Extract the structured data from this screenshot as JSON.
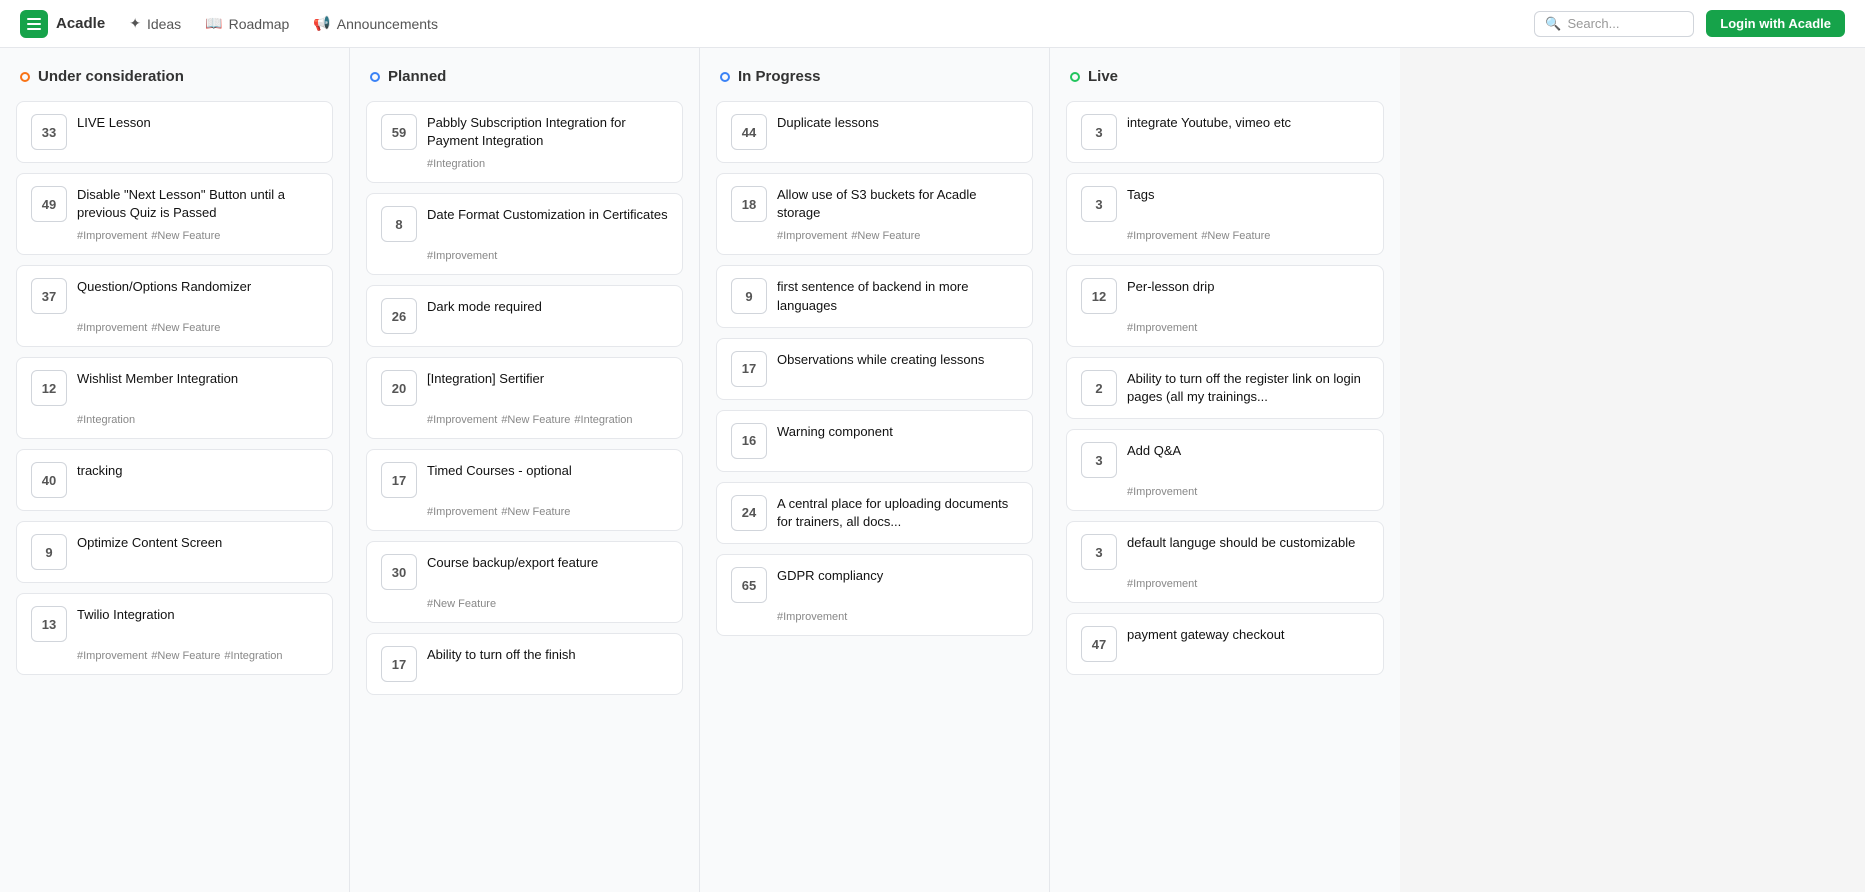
{
  "brand": {
    "name": "Acadle",
    "login_label": "Login with Acadle"
  },
  "nav": [
    {
      "id": "ideas",
      "label": "Ideas",
      "icon": "sparkle"
    },
    {
      "id": "roadmap",
      "label": "Roadmap",
      "icon": "book"
    },
    {
      "id": "announcements",
      "label": "Announcements",
      "icon": "megaphone"
    }
  ],
  "search": {
    "placeholder": "Search..."
  },
  "columns": [
    {
      "id": "under-consideration",
      "title": "Under consideration",
      "dot_class": "dot-orange",
      "cards": [
        {
          "votes": 33,
          "title": "LIVE Lesson",
          "tags": []
        },
        {
          "votes": 49,
          "title": "Disable \"Next Lesson\" Button until a previous Quiz is Passed",
          "tags": [
            "#Improvement",
            "#New Feature"
          ]
        },
        {
          "votes": 37,
          "title": "Question/Options Randomizer",
          "tags": [
            "#Improvement",
            "#New Feature"
          ]
        },
        {
          "votes": 12,
          "title": "Wishlist Member Integration",
          "tags": [
            "#Integration"
          ]
        },
        {
          "votes": 40,
          "title": "tracking",
          "tags": []
        },
        {
          "votes": 9,
          "title": "Optimize Content Screen",
          "tags": []
        },
        {
          "votes": 13,
          "title": "Twilio Integration",
          "tags": [
            "#Improvement",
            "#New Feature",
            "#Integration"
          ]
        }
      ]
    },
    {
      "id": "planned",
      "title": "Planned",
      "dot_class": "dot-blue",
      "cards": [
        {
          "votes": 59,
          "title": "Pabbly Subscription Integration for Payment Integration",
          "tags": [
            "#Integration"
          ]
        },
        {
          "votes": 8,
          "title": "Date Format Customization in Certificates",
          "tags": [
            "#Improvement"
          ]
        },
        {
          "votes": 26,
          "title": "Dark mode required",
          "tags": []
        },
        {
          "votes": 20,
          "title": "[Integration] Sertifier",
          "tags": [
            "#Improvement",
            "#New Feature",
            "#Integration"
          ]
        },
        {
          "votes": 17,
          "title": "Timed Courses - optional",
          "tags": [
            "#Improvement",
            "#New Feature"
          ]
        },
        {
          "votes": 30,
          "title": "Course backup/export feature",
          "tags": [
            "#New Feature"
          ]
        },
        {
          "votes": 17,
          "title": "Ability to turn off the finish",
          "tags": []
        }
      ]
    },
    {
      "id": "in-progress",
      "title": "In Progress",
      "dot_class": "dot-blue",
      "cards": [
        {
          "votes": 44,
          "title": "Duplicate lessons",
          "tags": []
        },
        {
          "votes": 18,
          "title": "Allow use of S3 buckets for Acadle storage",
          "tags": [
            "#Improvement",
            "#New Feature"
          ]
        },
        {
          "votes": 9,
          "title": "first sentence of backend in more languages",
          "tags": []
        },
        {
          "votes": 17,
          "title": "Observations while creating lessons",
          "tags": []
        },
        {
          "votes": 16,
          "title": "Warning component",
          "tags": []
        },
        {
          "votes": 24,
          "title": "A central place for uploading documents for trainers, all docs...",
          "tags": []
        },
        {
          "votes": 65,
          "title": "GDPR compliancy",
          "tags": [
            "#Improvement"
          ]
        }
      ]
    },
    {
      "id": "live",
      "title": "Live",
      "dot_class": "dot-green",
      "cards": [
        {
          "votes": 3,
          "title": "integrate Youtube, vimeo etc",
          "tags": []
        },
        {
          "votes": 3,
          "title": "Tags",
          "tags": [
            "#Improvement",
            "#New Feature"
          ]
        },
        {
          "votes": 12,
          "title": "Per-lesson drip",
          "tags": [
            "#Improvement"
          ]
        },
        {
          "votes": 2,
          "title": "Ability to turn off the register link on login pages (all my trainings...",
          "tags": []
        },
        {
          "votes": 3,
          "title": "Add Q&A",
          "tags": [
            "#Improvement"
          ]
        },
        {
          "votes": 3,
          "title": "default languge should be customizable",
          "tags": [
            "#Improvement"
          ]
        },
        {
          "votes": 47,
          "title": "payment gateway checkout",
          "tags": []
        }
      ]
    }
  ]
}
